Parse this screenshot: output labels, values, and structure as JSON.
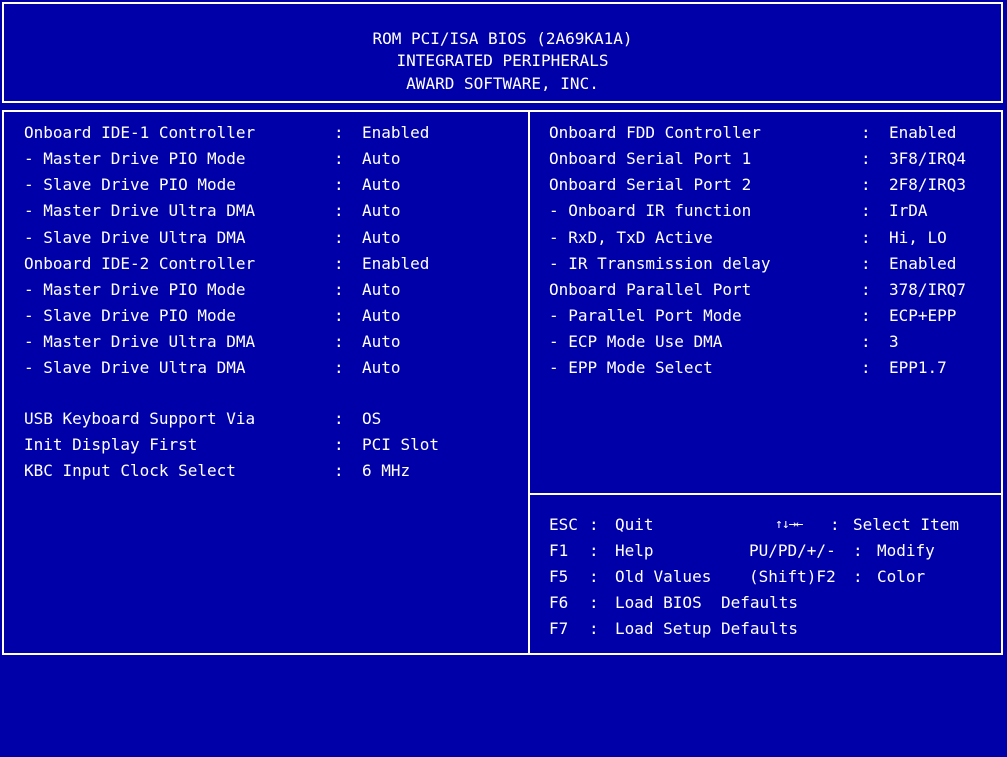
{
  "header": {
    "line1": "ROM PCI/ISA BIOS (2A69KA1A)",
    "line2": "INTEGRATED PERIPHERALS",
    "line3": "AWARD SOFTWARE, INC."
  },
  "separator": ":",
  "left_settings": [
    {
      "label": "Onboard IDE-1 Controller",
      "value": "Enabled"
    },
    {
      "label": "- Master Drive PIO Mode",
      "value": "Auto"
    },
    {
      "label": "- Slave Drive PIO Mode",
      "value": "Auto"
    },
    {
      "label": "- Master Drive Ultra DMA",
      "value": "Auto"
    },
    {
      "label": "- Slave Drive Ultra DMA",
      "value": "Auto"
    },
    {
      "label": "Onboard IDE-2 Controller",
      "value": "Enabled"
    },
    {
      "label": "- Master Drive PIO Mode",
      "value": "Auto"
    },
    {
      "label": "- Slave Drive PIO Mode",
      "value": "Auto"
    },
    {
      "label": "- Master Drive Ultra DMA",
      "value": "Auto"
    },
    {
      "label": "- Slave Drive Ultra DMA",
      "value": "Auto"
    },
    {
      "label": "USB Keyboard Support Via",
      "value": "OS"
    },
    {
      "label": "Init Display First",
      "value": "PCI Slot"
    },
    {
      "label": "KBC Input Clock Select",
      "value": "6 MHz"
    }
  ],
  "right_settings": [
    {
      "label": "Onboard FDD Controller",
      "value": "Enabled"
    },
    {
      "label": "Onboard Serial Port 1",
      "value": "3F8/IRQ4"
    },
    {
      "label": "Onboard Serial Port 2",
      "value": "2F8/IRQ3"
    },
    {
      "label": "- Onboard IR function",
      "value": "IrDA"
    },
    {
      "label": "- RxD, TxD Active",
      "value": "Hi, LO"
    },
    {
      "label": "- IR Transmission delay",
      "value": "Enabled"
    },
    {
      "label": "Onboard Parallel Port",
      "value": "378/IRQ7"
    },
    {
      "label": "- Parallel Port Mode",
      "value": "ECP+EPP"
    },
    {
      "label": "- ECP Mode Use DMA",
      "value": "3"
    },
    {
      "label": "- EPP Mode Select",
      "value": "EPP1.7"
    }
  ],
  "help": {
    "esc_key": "ESC",
    "esc_desc": "Quit",
    "arrows_icon": "↑↓→←",
    "arrows_desc": "Select Item",
    "f1_key": "F1",
    "f1_desc": "Help",
    "pu_key": "PU/PD/+/-",
    "pu_desc": "Modify",
    "f5_key": "F5",
    "f5_desc": "Old Values",
    "f2_key": "(Shift)F2",
    "f2_desc": "Color",
    "f6_key": "F6",
    "f6_desc": "Load BIOS  Defaults",
    "f7_key": "F7",
    "f7_desc": "Load Setup Defaults"
  },
  "colors": {
    "background": "#0000a8",
    "foreground": "#ffffff"
  }
}
